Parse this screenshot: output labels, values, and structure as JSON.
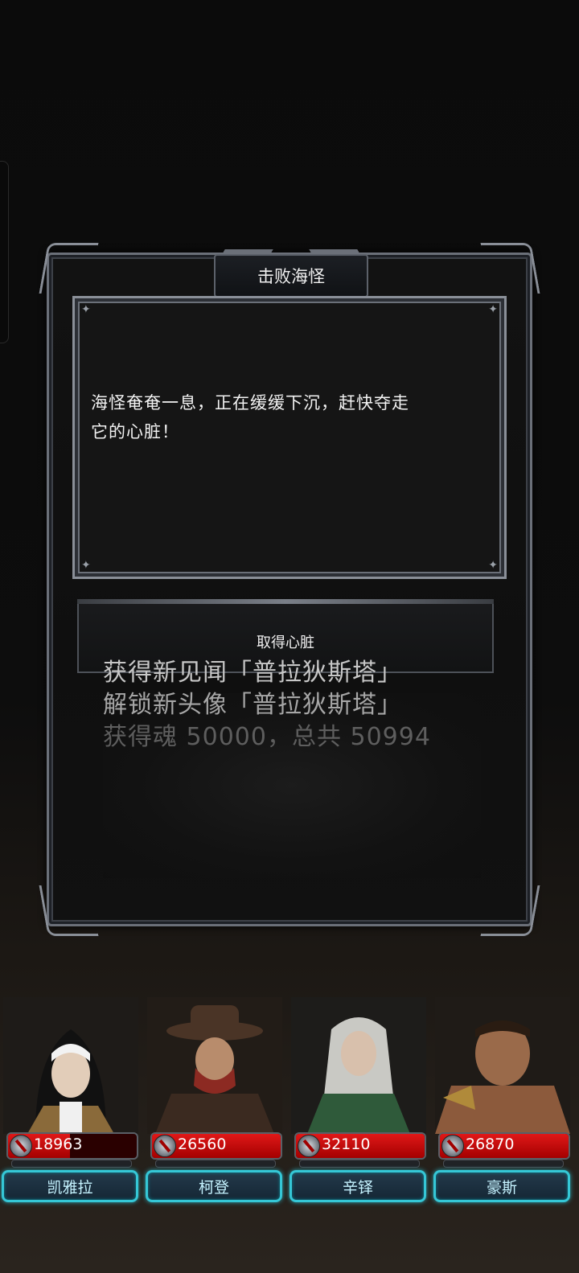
{
  "dialog": {
    "title": "击败海怪",
    "story_line1": "海怪奄奄一息，正在缓缓下沉，赶快夺走",
    "story_line2": "它的心脏！",
    "choice_label": "取得心脏"
  },
  "rewards": [
    "获得新见闻「普拉狄斯塔」",
    "解锁新头像「普拉狄斯塔」",
    "获得魂 50000，总共 50994"
  ],
  "party": [
    {
      "name": "凯雅拉",
      "hp": "18963",
      "hp_fill_percent": 48
    },
    {
      "name": "柯登",
      "hp": "26560",
      "hp_fill_percent": 100
    },
    {
      "name": "辛铎",
      "hp": "32110",
      "hp_fill_percent": 100
    },
    {
      "name": "豪斯",
      "hp": "26870",
      "hp_fill_percent": 100
    }
  ]
}
